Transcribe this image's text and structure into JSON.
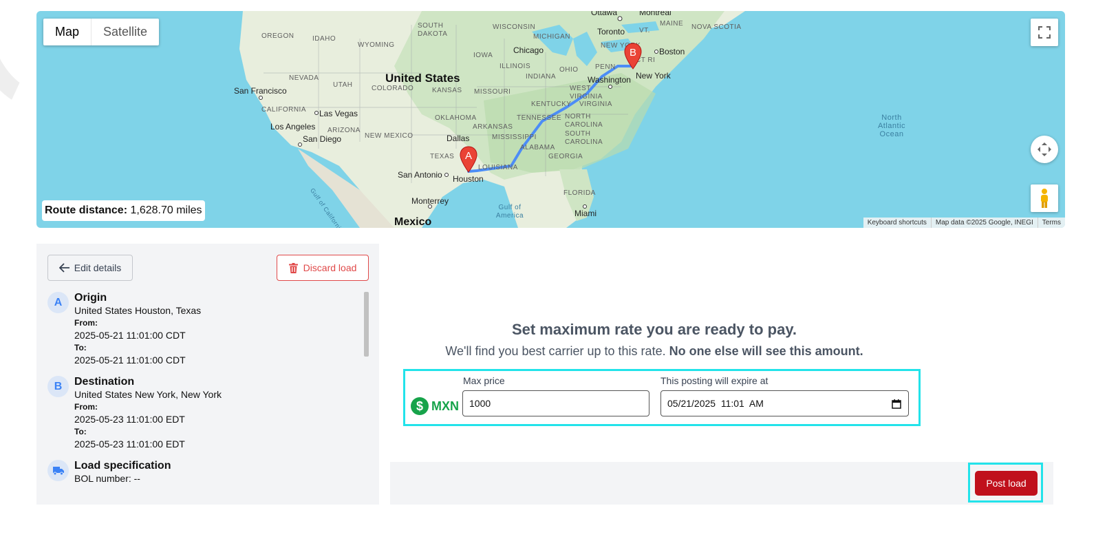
{
  "map": {
    "type_tabs": [
      "Map",
      "Satellite"
    ],
    "active_tab": "Map",
    "route_distance_label": "Route distance:",
    "route_distance_value": "1,628.70 miles",
    "marker_a": "A",
    "marker_b": "B",
    "attribution": [
      "Keyboard shortcuts",
      "Map data ©2025 Google, INEGI",
      "Terms"
    ],
    "labels": {
      "states": [
        "OREGON",
        "IDAHO",
        "WYOMING",
        "SOUTH DAKOTA",
        "WISCONSIN",
        "MICHIGAN",
        "IOWA",
        "ILLINOIS",
        "INDIANA",
        "OHIO",
        "PENN",
        "NEVADA",
        "UTAH",
        "COLORADO",
        "KANSAS",
        "MISSOURI",
        "CALIFORNIA",
        "ARIZONA",
        "NEW MEXICO",
        "OKLAHOMA",
        "ARKANSAS",
        "TENNESSEE",
        "KENTUCKY",
        "WEST VIRGINIA",
        "VIRGINIA",
        "NORTH CAROLINA",
        "SOUTH CAROLINA",
        "MISSISSIPPI",
        "ALABAMA",
        "GEORGIA",
        "TEXAS",
        "LOUISIANA",
        "FLORIDA",
        "MAINE",
        "NOVA SCOTIA",
        "NEW YORK",
        "VT.",
        "CT RI"
      ],
      "cities": [
        "Ottawa",
        "Montreal",
        "Toronto",
        "Chicago",
        "Boston",
        "New York",
        "Washington",
        "San Francisco",
        "Las Vegas",
        "Los Angeles",
        "San Diego",
        "Dallas",
        "San Antonio",
        "Houston",
        "Monterrey",
        "Miami"
      ],
      "countries": [
        "United States",
        "Mexico"
      ],
      "water": [
        "North Atlantic Ocean",
        "Gulf of America",
        "Gulf of California"
      ]
    }
  },
  "left_panel": {
    "edit_button": "Edit details",
    "discard_button": "Discard load",
    "origin": {
      "badge": "A",
      "title": "Origin",
      "location": "United States Houston, Texas",
      "from_label": "From:",
      "from_value": "2025-05-21 11:01:00 CDT",
      "to_label": "To:",
      "to_value": "2025-05-21 11:01:00 CDT"
    },
    "destination": {
      "badge": "B",
      "title": "Destination",
      "location": "United States New York, New York",
      "from_label": "From:",
      "from_value": "2025-05-23 11:01:00 EDT",
      "to_label": "To:",
      "to_value": "2025-05-23 11:01:00 EDT"
    },
    "load_spec": {
      "title": "Load specification",
      "bol": "BOL number: --"
    }
  },
  "rate": {
    "heading": "Set maximum rate you are ready to pay.",
    "sub_text": "We'll find you best carrier up to this rate.",
    "sub_bold": "No one else will see this amount.",
    "currency": "MXN",
    "max_price_label": "Max price",
    "max_price_value": "1000",
    "expire_label": "This posting will expire at",
    "expire_value": "05/21/2025  11:01  AM"
  },
  "footer": {
    "post_button": "Post load"
  },
  "colors": {
    "accent_cyan": "#22e3ea",
    "danger": "#e04848",
    "post_red": "#c0101c",
    "currency_green": "#16a34a",
    "route_blue": "#4c8df6"
  }
}
